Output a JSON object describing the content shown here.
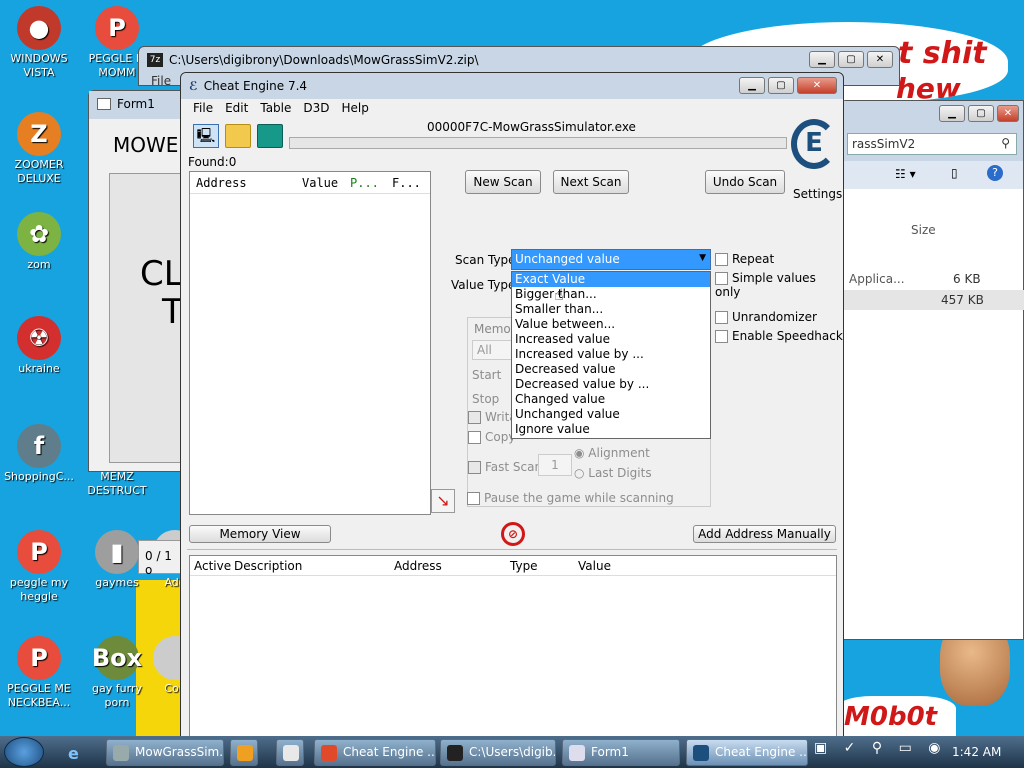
{
  "desktop": {
    "icons": [
      {
        "label": "WINDOWS VISTA",
        "glyph": "●",
        "color": "#c0392b"
      },
      {
        "label": "PEGGLE M MOMM",
        "glyph": "P",
        "color": "#e74c3c"
      },
      {
        "label": "ZOOMER DELUXE",
        "glyph": "Z",
        "color": "#e67e22"
      },
      {
        "label": "zom",
        "glyph": "✿",
        "color": "#7cb342"
      },
      {
        "label": "ukraine",
        "glyph": "☢",
        "color": "#d32f2f"
      },
      {
        "label": "ShoppingC...",
        "glyph": "f",
        "color": "#607d8b"
      },
      {
        "label": "MEMZ DESTRUCT",
        "glyph": "",
        "color": "#cccccc"
      },
      {
        "label": "peggle my heggle",
        "glyph": "P",
        "color": "#e74c3c"
      },
      {
        "label": "gaymes",
        "glyph": "▮",
        "color": "#9e9e9e"
      },
      {
        "label": "Ado",
        "glyph": "",
        "color": "#cccccc"
      },
      {
        "label": "PEGGLE ME NECKBEA...",
        "glyph": "P",
        "color": "#e74c3c"
      },
      {
        "label": "gay furry porn",
        "glyph": "Box",
        "color": "#6d8b3a"
      },
      {
        "label": "Con",
        "glyph": "",
        "color": "#cccccc"
      }
    ],
    "banner_top": "t shit",
    "banner_top2": "hew",
    "banner_bottom": "M0b0t"
  },
  "zip_window": {
    "title": "C:\\Users\\digibrony\\Downloads\\MowGrassSimV2.zip\\",
    "menu_file": "File"
  },
  "form1": {
    "title": "Form1",
    "mow_text": "MOWE",
    "big_text_1": "CL",
    "big_text_2": "T",
    "status": "0 / 1 o"
  },
  "explorer": {
    "breadcrumb": "rassSimV2",
    "col_size": "Size",
    "rows": [
      {
        "name": "Applica...",
        "size": "6 KB"
      },
      {
        "name": "",
        "size": "457 KB"
      }
    ]
  },
  "cheat_engine": {
    "title": "Cheat Engine 7.4",
    "menu": [
      "File",
      "Edit",
      "Table",
      "D3D",
      "Help"
    ],
    "process": "00000F7C-MowGrassSimulator.exe",
    "found": "Found:0",
    "list_headers": [
      "Address",
      "Value",
      "P...",
      "F..."
    ],
    "new_scan": "New Scan",
    "next_scan": "Next Scan",
    "undo_scan": "Undo Scan",
    "settings": "Settings",
    "scan_type_label": "Scan Type",
    "scan_type_value": "Unchanged value",
    "value_type_label": "Value Type",
    "dropdown_options": [
      "Exact Value",
      "Bigger than...",
      "Smaller than...",
      "Value between...",
      "Increased value",
      "Increased value by ...",
      "Decreased value",
      "Decreased value by ...",
      "Changed value",
      "Unchanged value",
      "Ignore value"
    ],
    "dropdown_selected_index": 0,
    "repeat": "Repeat",
    "simple_values": "Simple values only",
    "unrandomizer": "Unrandomizer",
    "speedhack": "Enable Speedhack",
    "memory_label": "Memor",
    "memory_all": "All",
    "start": "Start",
    "stop": "Stop",
    "writable": "Writa",
    "copy_on_write": "Copy",
    "fast_scan": "Fast Scan",
    "fast_scan_value": "1",
    "alignment": "Alignment",
    "last_digits": "Last Digits",
    "pause_game": "Pause the game while scanning",
    "memory_view": "Memory View",
    "add_address": "Add Address Manually",
    "table_headers": [
      "Active",
      "Description",
      "Address",
      "Type",
      "Value"
    ]
  },
  "taskbar": {
    "items": [
      "MowGrassSim...",
      "",
      "",
      "Cheat Engine ...",
      "C:\\Users\\digib...",
      "Form1",
      "Cheat Engine ..."
    ],
    "clock": "1:42 AM"
  }
}
